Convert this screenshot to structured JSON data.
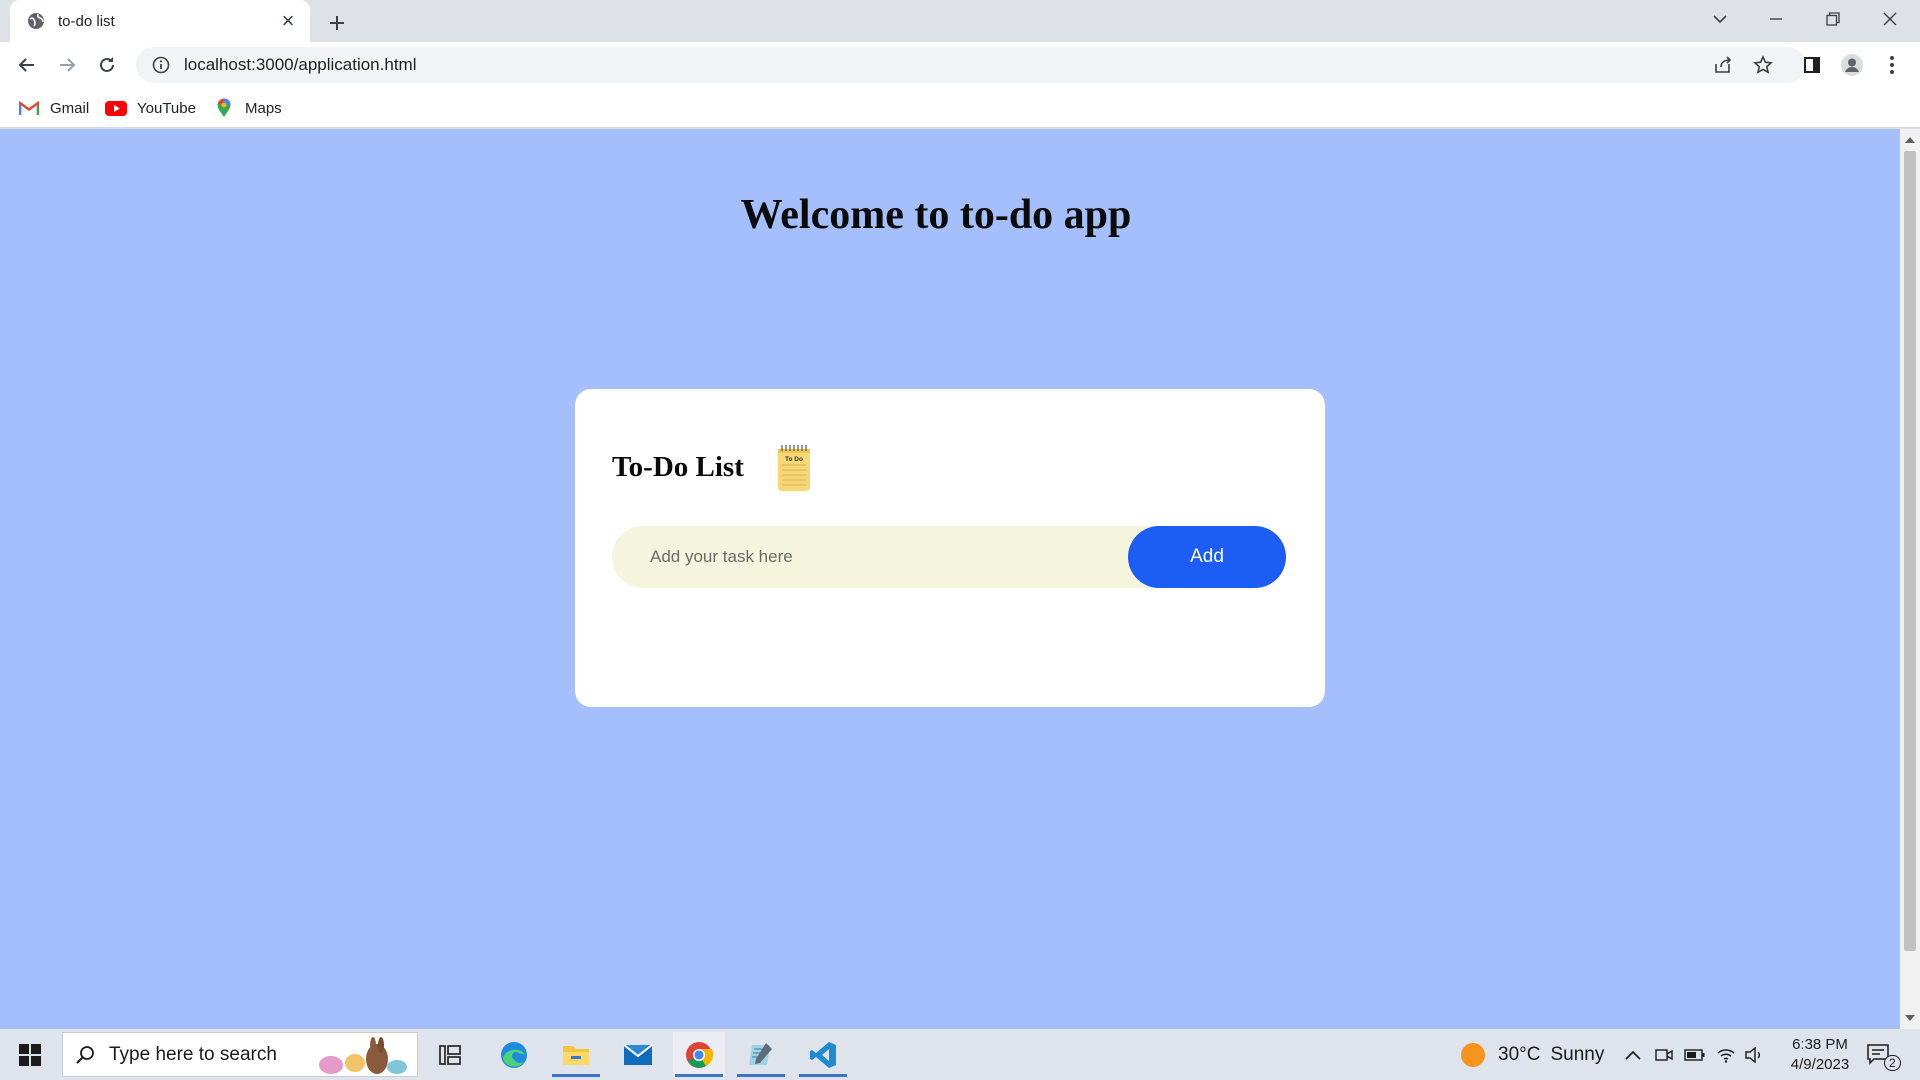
{
  "browser": {
    "tab": {
      "title": "to-do list",
      "close_label": "×"
    },
    "address": {
      "url": "localhost:3000/application.html"
    },
    "bookmarks": [
      {
        "label": "Gmail"
      },
      {
        "label": "YouTube"
      },
      {
        "label": "Maps"
      }
    ]
  },
  "page": {
    "heading": "Welcome to to-do app",
    "card": {
      "title": "To-Do List",
      "icon": "notepad-icon",
      "icon_text": "To Do",
      "input_placeholder": "Add your task here",
      "add_label": "Add"
    },
    "colors": {
      "background": "#a4bffc",
      "card": "#ffffff",
      "input": "#f5f4dd",
      "button": "#1b5df5"
    }
  },
  "taskbar": {
    "search_placeholder": "Type here to search",
    "weather": {
      "temp": "30°C",
      "condition": "Sunny"
    },
    "clock": {
      "time": "6:38 PM",
      "date": "4/9/2023"
    },
    "notifications": "2"
  }
}
